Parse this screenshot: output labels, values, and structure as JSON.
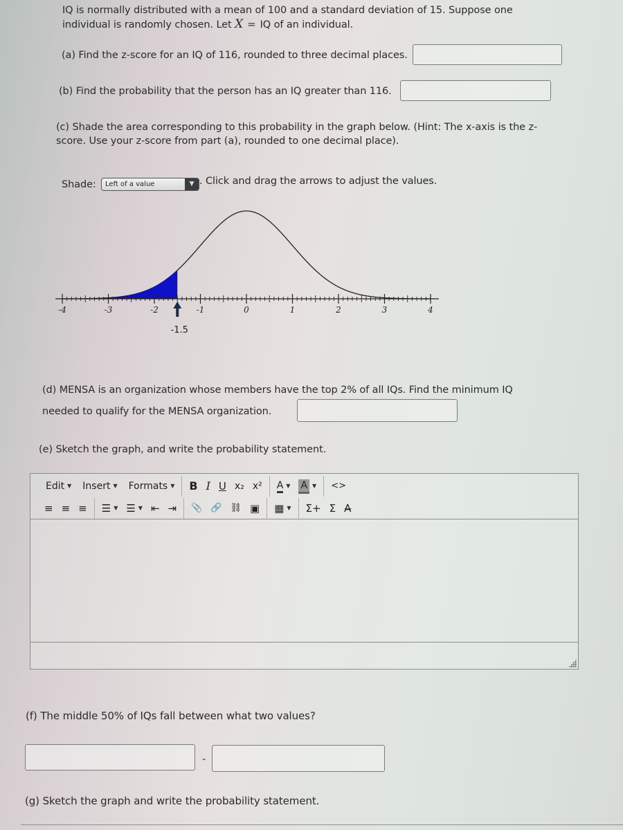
{
  "intro": {
    "line1": "IQ is normally distributed with a mean of 100 and a standard deviation of 15. Suppose one",
    "line2_prefix": "individual is randomly chosen. Let",
    "variable": "X",
    "equals": "=",
    "line2_suffix": "IQ of an individual."
  },
  "part_a": {
    "label": "(a) Find the z-score for an IQ of 116, rounded to three decimal places.",
    "value": ""
  },
  "part_b": {
    "label": "(b) Find the probability that the person has an IQ greater than 116.",
    "value": ""
  },
  "part_c": {
    "line1": "(c) Shade the area corresponding to this probability in the graph below. (Hint: The x-axis is the z-",
    "line2": "score. Use your z-score from part (a), rounded to one decimal place).",
    "shade_label": "Shade:",
    "shade_selected": "Left of a value",
    "instructions": ". Click and drag the arrows to adjust the values."
  },
  "chart_data": {
    "type": "area",
    "title": "",
    "xlabel": "",
    "ylabel": "",
    "distribution": "standard normal",
    "mean": 0,
    "sd": 1,
    "xlim": [
      -4,
      4
    ],
    "tick_labels": [
      "-4",
      "-3",
      "-2",
      "-1",
      "0",
      "1",
      "2",
      "3",
      "4"
    ],
    "major_ticks": [
      -4,
      -3,
      -2,
      -1,
      0,
      1,
      2,
      3,
      4
    ],
    "minor_tick_step": 0.1,
    "shade_mode": "left",
    "shade_from": -4,
    "shade_to": -1.5,
    "marker_value": -1.5,
    "marker_label": "-1.5",
    "shade_color": "#1010c8",
    "curve_color": "#222222",
    "marker_color": "#1c2a4a",
    "grid": false
  },
  "part_d": {
    "line1": "(d) MENSA is an organization whose members have the top 2% of all IQs. Find the minimum IQ",
    "line2": "needed to qualify for the MENSA organization.",
    "value": ""
  },
  "part_e": {
    "label": "(e) Sketch the graph, and write the probability statement."
  },
  "editor": {
    "menus": [
      "Edit",
      "Insert",
      "Formats"
    ],
    "format_buttons": [
      {
        "name": "bold",
        "glyph": "B"
      },
      {
        "name": "italic",
        "glyph": "I"
      },
      {
        "name": "underline",
        "glyph": "U"
      },
      {
        "name": "subscript",
        "glyph": "x₂"
      },
      {
        "name": "superscript",
        "glyph": "x²"
      }
    ],
    "text_color_glyph": "A",
    "bg_color_glyph": "A",
    "source_code_glyph": "<>",
    "row2": {
      "align_left": "≡",
      "align_center": "≡",
      "align_right": "≡",
      "bullet_list": "☰",
      "numbered_list": "☰",
      "outdent": "⇤",
      "indent": "⇥",
      "attach": "📎",
      "link": "🔗",
      "unlink": "⛓",
      "image": "▣",
      "table": "▦",
      "sum_plus": "Σ+",
      "sum": "Σ",
      "special_char": "A̶"
    },
    "content": ""
  },
  "part_f": {
    "label": "(f) The middle 50% of IQs fall between what two values?",
    "low_value": "",
    "separator": "-",
    "high_value": ""
  },
  "part_g": {
    "label": "(g) Sketch the graph and write the probability statement."
  }
}
